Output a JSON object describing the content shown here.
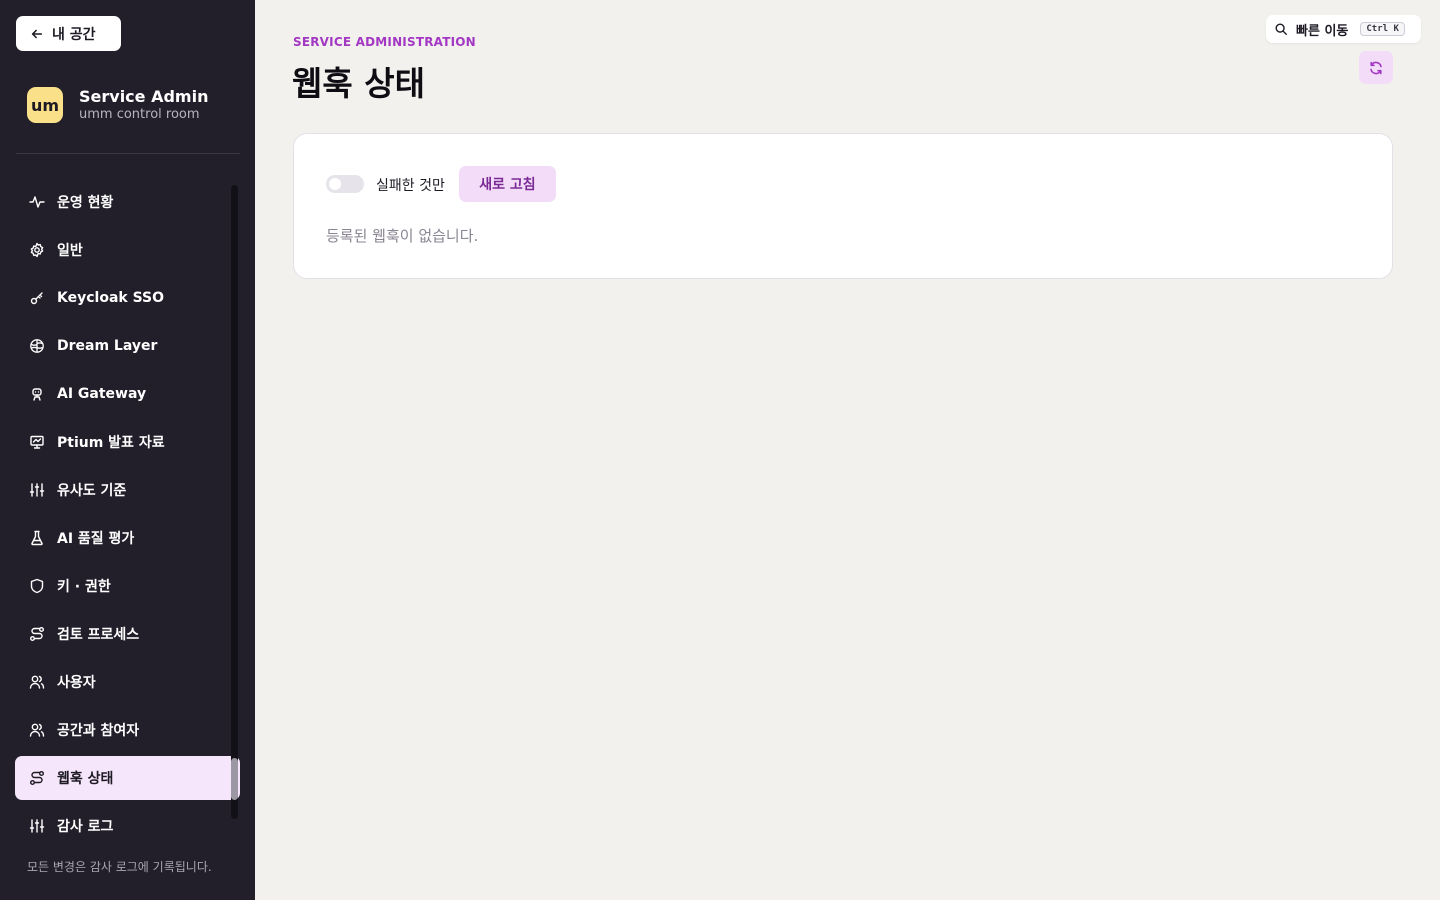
{
  "sidebar": {
    "back_label": "내 공간",
    "brand": {
      "logo": "um",
      "title": "Service Admin",
      "subtitle": "umm control room"
    },
    "items": [
      {
        "label": "운영 현황",
        "icon": "activity-icon"
      },
      {
        "label": "일반",
        "icon": "gear-icon"
      },
      {
        "label": "Keycloak SSO",
        "icon": "key-icon"
      },
      {
        "label": "Dream Layer",
        "icon": "brain-icon"
      },
      {
        "label": "AI Gateway",
        "icon": "robot-icon"
      },
      {
        "label": "Ptium 발표 자료",
        "icon": "presentation-icon"
      },
      {
        "label": "유사도 기준",
        "icon": "sliders-icon"
      },
      {
        "label": "AI 품질 평가",
        "icon": "flask-icon"
      },
      {
        "label": "키 · 권한",
        "icon": "shield-icon"
      },
      {
        "label": "검토 프로세스",
        "icon": "route-icon"
      },
      {
        "label": "사용자",
        "icon": "users-icon"
      },
      {
        "label": "공간과 참여자",
        "icon": "users-icon"
      },
      {
        "label": "웹훅 상태",
        "icon": "route-icon",
        "active": true
      },
      {
        "label": "감사 로그",
        "icon": "sliders-icon"
      }
    ],
    "footnote": "모든 변경은 감사 로그에 기록됩니다."
  },
  "header": {
    "eyebrow": "SERVICE ADMINISTRATION",
    "title": "웹훅 상태",
    "quick_jump": {
      "label": "빠른 이동",
      "shortcut": "Ctrl K"
    }
  },
  "card": {
    "toggle_label": "실패한 것만",
    "toggle_on": false,
    "refresh_label": "새로 고침",
    "empty_text": "등록된 웹훅이 없습니다."
  },
  "colors": {
    "sidebar_bg": "#221f2a",
    "page_bg": "#f3f1ed",
    "accent": "#a338c4",
    "active_item_bg": "#f6e6fb",
    "brand_logo_bg": "#fbe08a"
  }
}
